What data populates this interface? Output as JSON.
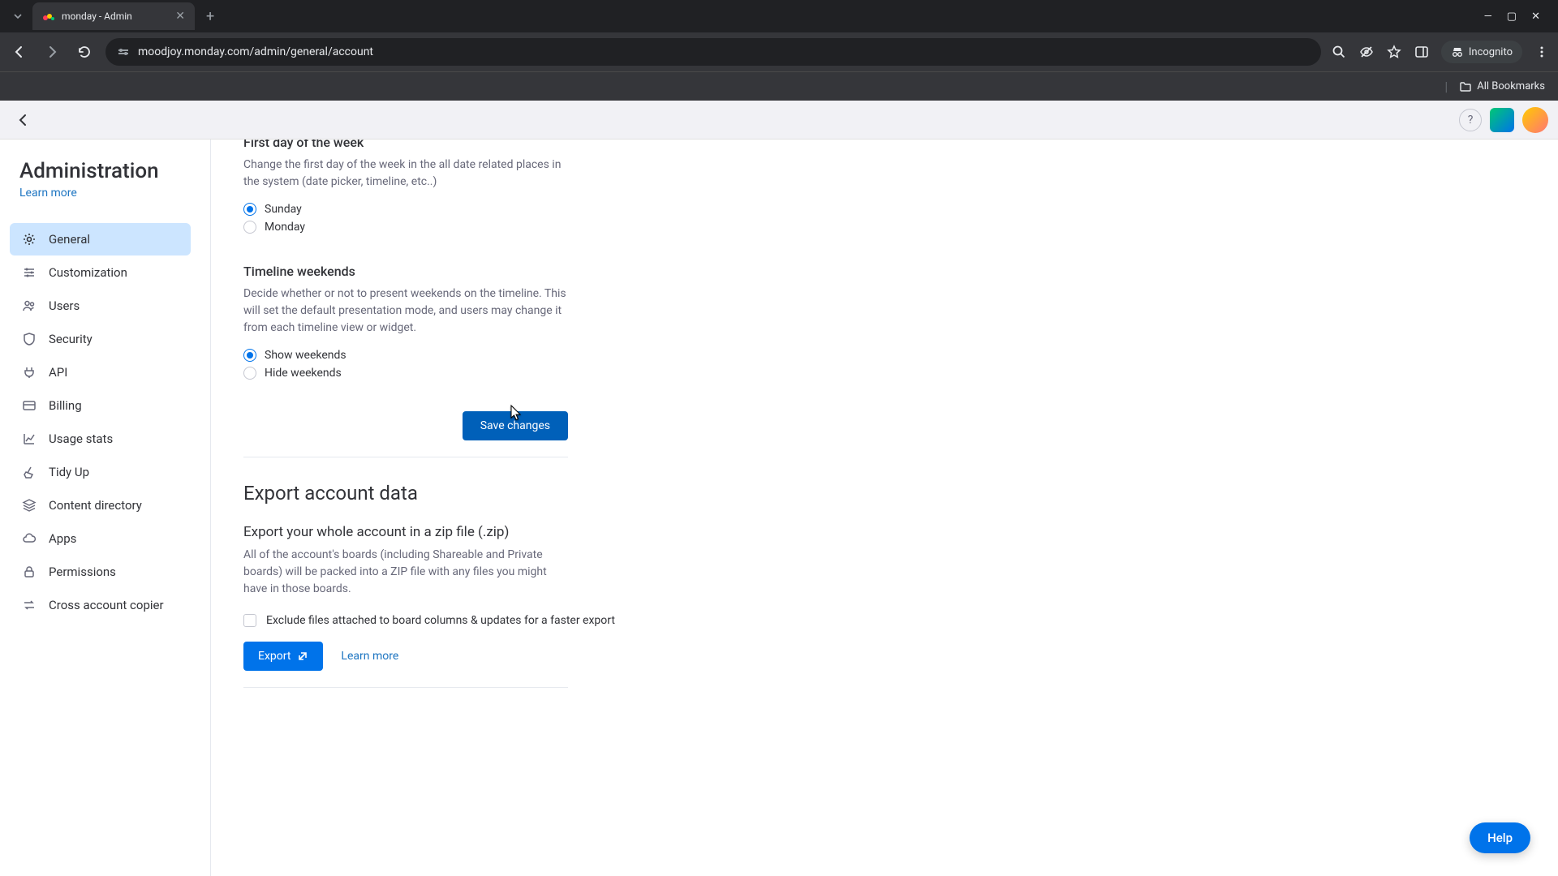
{
  "browser": {
    "tab_title": "monday - Admin",
    "url": "moodjoy.monday.com/admin/general/account",
    "incognito_label": "Incognito",
    "all_bookmarks": "All Bookmarks"
  },
  "sidebar": {
    "title": "Administration",
    "learn_more": "Learn more",
    "items": [
      {
        "label": "General",
        "icon": "gear"
      },
      {
        "label": "Customization",
        "icon": "sliders"
      },
      {
        "label": "Users",
        "icon": "users"
      },
      {
        "label": "Security",
        "icon": "shield"
      },
      {
        "label": "API",
        "icon": "plug"
      },
      {
        "label": "Billing",
        "icon": "card"
      },
      {
        "label": "Usage stats",
        "icon": "chart"
      },
      {
        "label": "Tidy Up",
        "icon": "broom"
      },
      {
        "label": "Content directory",
        "icon": "layers"
      },
      {
        "label": "Apps",
        "icon": "cloud"
      },
      {
        "label": "Permissions",
        "icon": "lock"
      },
      {
        "label": "Cross account copier",
        "icon": "transfer"
      }
    ]
  },
  "content": {
    "first_day": {
      "title": "First day of the week",
      "desc": "Change the first day of the week in the all date related places in the system (date picker, timeline, etc..)",
      "options": [
        "Sunday",
        "Monday"
      ],
      "selected": "Sunday"
    },
    "weekends": {
      "title": "Timeline weekends",
      "desc": "Decide whether or not to present weekends on the timeline. This will set the default presentation mode, and users may change it from each timeline view or widget.",
      "options": [
        "Show weekends",
        "Hide weekends"
      ],
      "selected": "Show weekends"
    },
    "save_label": "Save changes",
    "export": {
      "heading": "Export account data",
      "sub": "Export your whole account in a zip file (.zip)",
      "desc": "All of the account's boards (including Shareable and Private boards) will be packed into a ZIP file with any files you might have in those boards.",
      "checkbox": "Exclude files attached to board columns & updates for a faster export",
      "button": "Export",
      "learn_more": "Learn more"
    }
  },
  "help_fab": "Help"
}
